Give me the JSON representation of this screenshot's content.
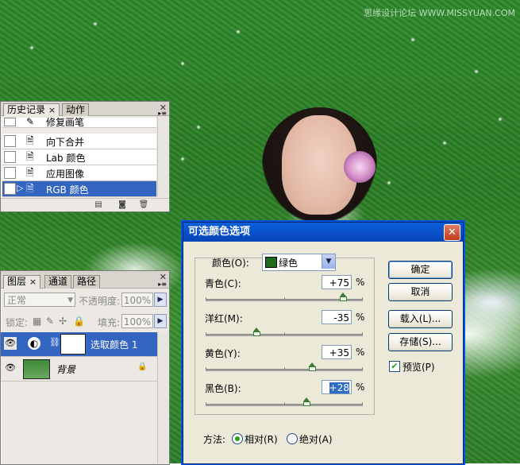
{
  "watermark": "思缘设计论坛 WWW.MISSYUAN.COM",
  "history_panel": {
    "tabs": [
      "历史记录",
      "动作"
    ],
    "items": [
      {
        "label": "修复画笔",
        "icon": "brush-icon"
      },
      {
        "label": "向下合并",
        "icon": "document-icon"
      },
      {
        "label": "Lab 颜色",
        "icon": "document-icon"
      },
      {
        "label": "应用图像",
        "icon": "document-icon"
      },
      {
        "label": "RGB 颜色",
        "icon": "document-icon",
        "selected": true
      }
    ],
    "close_glyph": "×"
  },
  "layers_panel": {
    "tabs": [
      "图层",
      "通道",
      "路径"
    ],
    "blend_mode": "正常",
    "opacity_label": "不透明度:",
    "opacity_value": "100%",
    "lock_label": "锁定:",
    "fill_label": "填充:",
    "fill_value": "100%",
    "layers": [
      {
        "name": "选取颜色 1",
        "selected": true
      },
      {
        "name": "背景",
        "italic": true
      }
    ]
  },
  "dialog": {
    "title": "可选颜色选项",
    "color_label": "颜色(O):",
    "color_value": "绿色",
    "swatch_color": "#1f6a1f",
    "sliders": [
      {
        "label": "青色(C):",
        "value": "+75",
        "percent": 75
      },
      {
        "label": "洋红(M):",
        "value": "-35",
        "percent": -35
      },
      {
        "label": "黄色(Y):",
        "value": "+35",
        "percent": 35
      },
      {
        "label": "黑色(B):",
        "value": "+28",
        "percent": 28
      }
    ],
    "unit": "%",
    "buttons": {
      "ok": "确定",
      "cancel": "取消",
      "load": "载入(L)...",
      "save": "存储(S)..."
    },
    "preview_label": "预览(P)",
    "preview_checked": true,
    "method_label": "方法:",
    "method_relative": "相对(R)",
    "method_absolute": "绝对(A)",
    "method_selected": "relative"
  }
}
